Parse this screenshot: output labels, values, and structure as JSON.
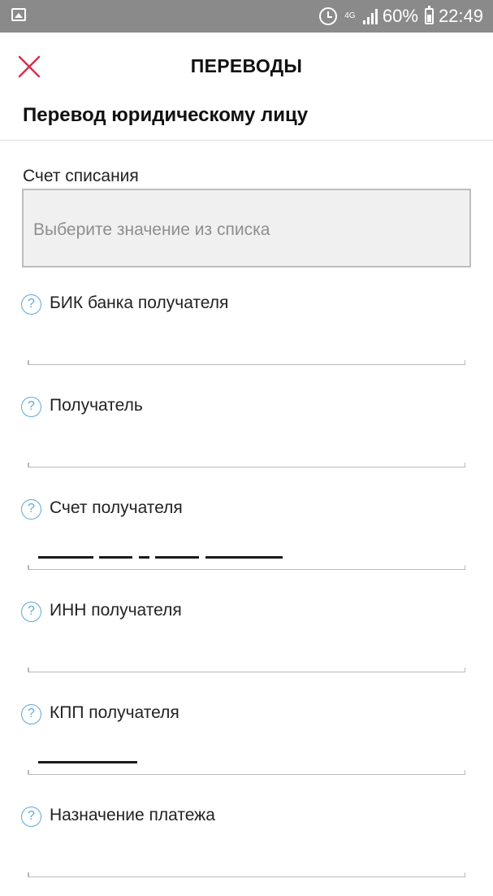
{
  "status_bar": {
    "network": "4G",
    "battery": "60%",
    "time": "22:49"
  },
  "app_bar": {
    "title": "ПЕРЕВОДЫ"
  },
  "form": {
    "section_title": "Перевод юридическому лицу",
    "account": {
      "label": "Счет списания",
      "placeholder": "Выберите значение из списка"
    },
    "fields": [
      {
        "label": "БИК банка получателя"
      },
      {
        "label": "Получатель"
      },
      {
        "label": "Счет получателя"
      },
      {
        "label": "ИНН получателя"
      },
      {
        "label": "КПП получателя"
      },
      {
        "label": "Назначение платежа"
      }
    ]
  },
  "colors": {
    "status_bar_bg": "#8a8a8a",
    "close_icon": "#d6304b",
    "help_icon": "#5aa8d9",
    "select_bg": "#f0f0f0"
  },
  "icons": {
    "close": "close-icon",
    "help": "help-icon",
    "gallery": "gallery-notification-icon",
    "alarm": "alarm-icon",
    "signal": "signal-icon",
    "battery": "battery-icon"
  }
}
